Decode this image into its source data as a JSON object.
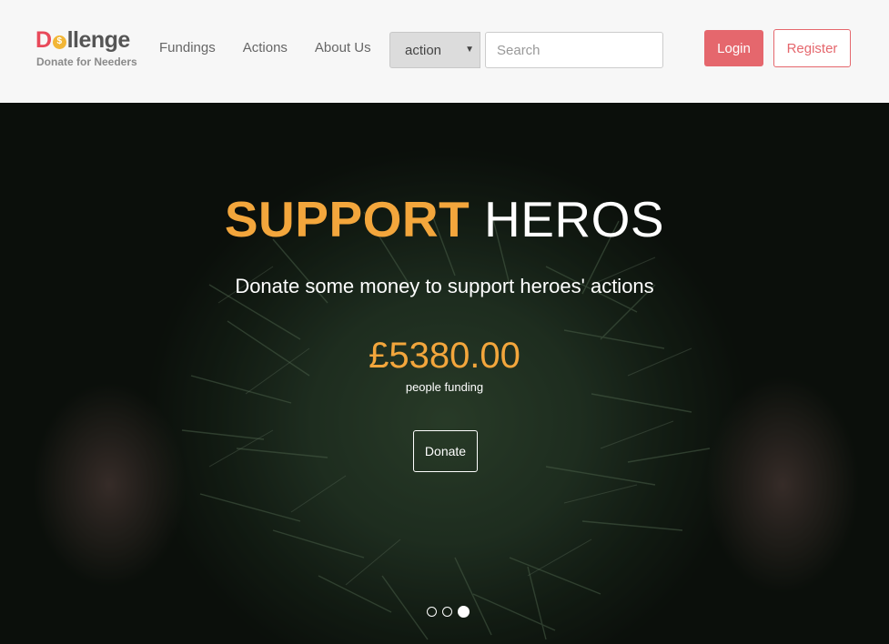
{
  "brand": {
    "logo_d": "D",
    "logo_coin": "$",
    "logo_rest": "llenge",
    "tagline": "Donate for Needers"
  },
  "nav": {
    "links": [
      "Fundings",
      "Actions",
      "About Us"
    ]
  },
  "search": {
    "category_selected": "action",
    "placeholder": "Search"
  },
  "auth": {
    "login_label": "Login",
    "register_label": "Register"
  },
  "hero": {
    "title_accent": "SUPPORT",
    "title_rest": "HEROS",
    "subtitle": "Donate some money to support heroes' actions",
    "amount": "£5380.00",
    "amount_label": "people funding",
    "donate_label": "Donate",
    "carousel": {
      "total": 3,
      "active_index": 2
    }
  },
  "colors": {
    "accent_orange": "#f3a63c",
    "brand_red": "#e5676d",
    "coin_gold": "#f2b636"
  }
}
